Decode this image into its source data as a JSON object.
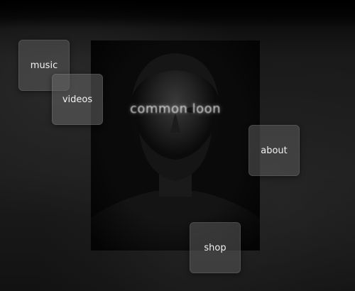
{
  "site": {
    "title": "common loon"
  },
  "nav": {
    "music": "music",
    "videos": "videos",
    "about": "about",
    "shop": "shop"
  },
  "colors": {
    "background": "#101010",
    "tile": "#5a5a5a",
    "text": "#f2f2f2"
  }
}
